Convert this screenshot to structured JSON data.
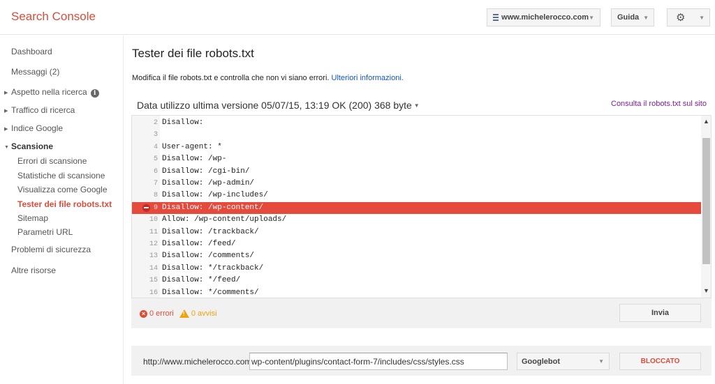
{
  "header": {
    "brand": "Search Console",
    "site": "www.michelerocco.com",
    "help_label": "Guida"
  },
  "sidebar": {
    "dashboard": "Dashboard",
    "messages": "Messaggi (2)",
    "search_appearance": "Aspetto nella ricerca",
    "search_traffic": "Traffico di ricerca",
    "google_index": "Indice Google",
    "crawl": "Scansione",
    "crawl_errors": "Errori di scansione",
    "crawl_stats": "Statistiche di scansione",
    "fetch_as_google": "Visualizza come Google",
    "robots_tester": "Tester dei file robots.txt",
    "sitemap": "Sitemap",
    "url_params": "Parametri URL",
    "security": "Problemi di sicurezza",
    "other_resources": "Altre risorse"
  },
  "main": {
    "title": "Tester dei file robots.txt",
    "description": "Modifica il file robots.txt e controlla che non vi siano errori.",
    "learn_more": "Ulteriori informazioni.",
    "version": "Data utilizzo ultima versione 05/07/15, 13:19 OK (200) 368 byte",
    "live_link": "Consulta il robots.txt sul sito"
  },
  "editor": {
    "lines": [
      {
        "n": "2",
        "text": "Disallow:",
        "error": false
      },
      {
        "n": "3",
        "text": "",
        "error": false
      },
      {
        "n": "4",
        "text": "User-agent: *",
        "error": false
      },
      {
        "n": "5",
        "text": "Disallow: /wp-",
        "error": false
      },
      {
        "n": "6",
        "text": "Disallow: /cgi-bin/",
        "error": false
      },
      {
        "n": "7",
        "text": "Disallow: /wp-admin/",
        "error": false
      },
      {
        "n": "8",
        "text": "Disallow: /wp-includes/",
        "error": false
      },
      {
        "n": "9",
        "text": "Disallow: /wp-content/",
        "error": true
      },
      {
        "n": "10",
        "text": "Allow: /wp-content/uploads/",
        "error": false
      },
      {
        "n": "11",
        "text": "Disallow: /trackback/",
        "error": false
      },
      {
        "n": "12",
        "text": "Disallow: /feed/",
        "error": false
      },
      {
        "n": "13",
        "text": "Disallow: /comments/",
        "error": false
      },
      {
        "n": "14",
        "text": "Disallow: */trackback/",
        "error": false
      },
      {
        "n": "15",
        "text": "Disallow: */feed/",
        "error": false
      },
      {
        "n": "16",
        "text": "Disallow: */comments/",
        "error": false
      }
    ]
  },
  "status": {
    "errors": "0 errori",
    "warnings": "0 avvisi",
    "submit_label": "Invia"
  },
  "tester": {
    "base_url": "http://www.michelerocco.com/",
    "path_value": "wp-content/plugins/contact-form-7/includes/css/styles.css",
    "agent": "Googlebot",
    "result": "BLOCCATO"
  },
  "colors": {
    "accent": "#dd4b39",
    "link": "#1155cc",
    "visited_link": "#7b1fa2",
    "error_line": "#e64a3c",
    "warning": "#f0a30a"
  }
}
